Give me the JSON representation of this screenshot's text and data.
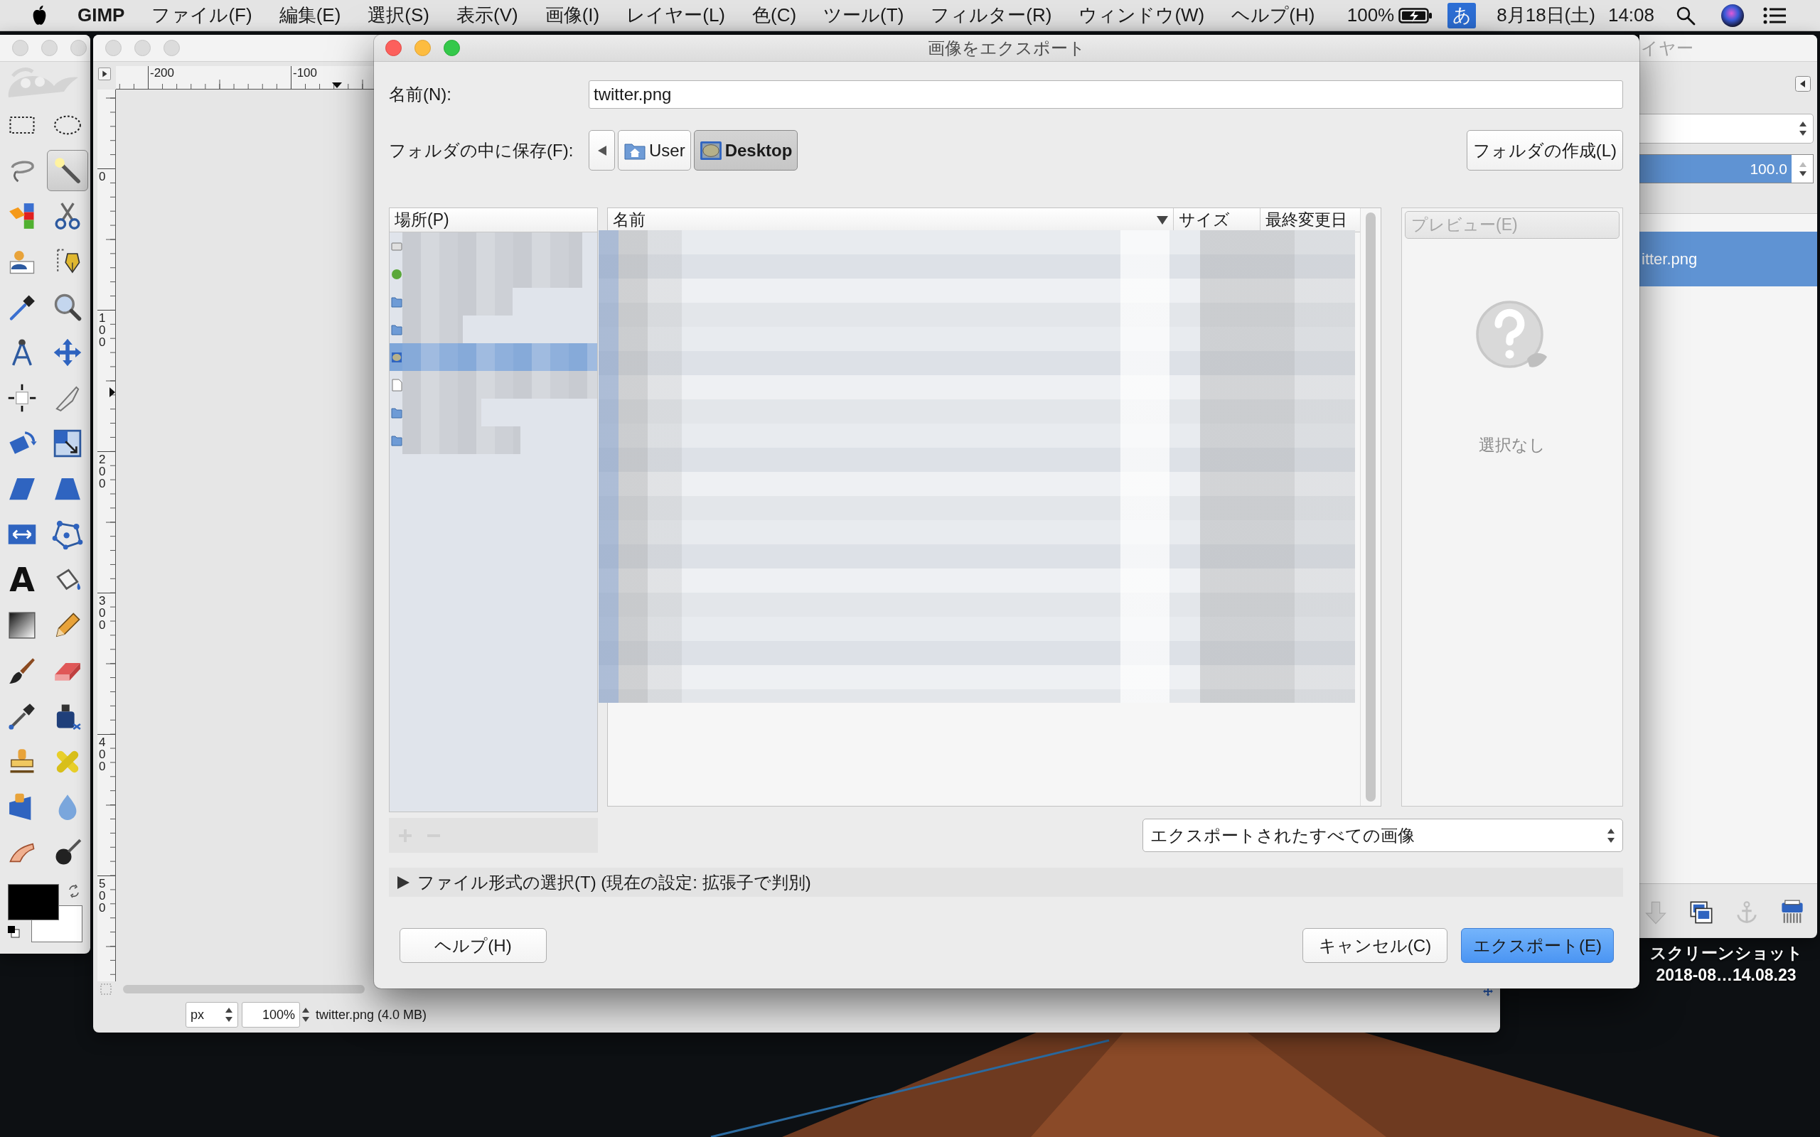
{
  "menu_bar": {
    "app_name": "GIMP",
    "menus": [
      "ファイル(F)",
      "編集(E)",
      "選択(S)",
      "表示(V)",
      "画像(I)",
      "レイヤー(L)",
      "色(C)",
      "ツール(T)",
      "フィルター(R)",
      "ウィンドウ(W)",
      "ヘルプ(H)"
    ],
    "battery": "100%",
    "input_method": "あ",
    "date": "8月18日(土)",
    "time": "14:08"
  },
  "toolbox": {
    "tools": [
      {
        "selected": false
      },
      {
        "selected": false
      },
      {
        "selected": false
      },
      {
        "selected": true
      },
      {
        "selected": false
      },
      {
        "selected": false
      },
      {
        "selected": false
      },
      {
        "selected": false
      },
      {
        "selected": false
      },
      {
        "selected": false
      },
      {
        "selected": false
      },
      {
        "selected": false
      },
      {
        "selected": false
      },
      {
        "selected": false
      },
      {
        "selected": false
      },
      {
        "selected": false
      },
      {
        "selected": false
      },
      {
        "selected": false
      },
      {
        "selected": false
      },
      {
        "selected": false
      },
      {
        "glyph": "A",
        "selected": false
      },
      {
        "selected": false
      },
      {
        "selected": false
      },
      {
        "selected": false
      },
      {
        "selected": false
      },
      {
        "selected": false
      },
      {
        "selected": false
      },
      {
        "selected": false
      },
      {
        "selected": false
      },
      {
        "selected": false
      },
      {
        "selected": false
      },
      {
        "selected": false
      },
      {
        "selected": false
      },
      {
        "selected": false
      }
    ],
    "colors": [
      {
        "color": "#000000"
      },
      {
        "color": "#ffffff"
      }
    ]
  },
  "image_window": {
    "rulers": {
      "horizontal": [
        "-200",
        "-100"
      ],
      "vertical": [
        "0",
        "100",
        "200",
        "300",
        "400",
        "500"
      ]
    },
    "status_bar": {
      "unit": "px",
      "zoom": "100%",
      "file_info": "twitter.png (4.0 MB)"
    }
  },
  "layers_window": {
    "title": "イヤー",
    "opacity": {
      "value": "100.0",
      "level": 1
    },
    "layers": [
      {
        "name": "itter.png",
        "selected": true
      }
    ]
  },
  "export_dialog": {
    "title": "画像をエクスポート",
    "name_label": "名前(N):",
    "name_value": "twitter.png",
    "folder_label": "フォルダの中に保存(F):",
    "path_buttons": [
      {
        "label": "User",
        "selected": false
      },
      {
        "label": "Desktop",
        "selected": true
      }
    ],
    "create_folder_button": "フォルダの作成(L)",
    "places": {
      "header": "場所(P)",
      "rows": [
        {
          "selected": false
        },
        {
          "selected": false
        },
        {
          "selected": false
        },
        {
          "selected": false
        },
        {
          "selected": true
        },
        {
          "selected": false
        },
        {
          "selected": false
        },
        {
          "selected": false
        }
      ]
    },
    "files": {
      "columns": [
        {
          "label": "名前",
          "sorted": true
        },
        {
          "label": "サイズ",
          "sorted": false
        },
        {
          "label": "最終変更日",
          "sorted": false
        }
      ]
    },
    "preview": {
      "button": {
        "label": "プレビュー(E)",
        "disabled": true
      },
      "status": "選択なし"
    },
    "filter": "エクスポートされたすべての画像",
    "file_type_expander": {
      "label": "ファイル形式の選択(T) (現在の設定: 拡張子で判別)",
      "expanded": false
    },
    "buttons": [
      {
        "label": "ヘルプ(H)",
        "default": false
      },
      {
        "label": "キャンセル(C)",
        "default": false
      },
      {
        "label": "エクスポート(E)",
        "default": true
      }
    ]
  },
  "desktop": {
    "file_label_lines": [
      "スクリーンショット",
      "2018-08…14.08.23"
    ]
  }
}
